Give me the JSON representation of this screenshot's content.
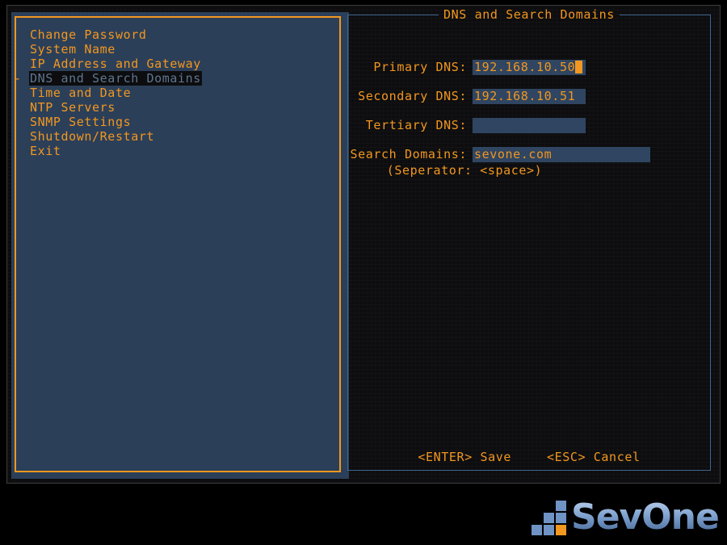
{
  "screen": {
    "background_color": "#000000",
    "terminal_background": "#0d0d0f",
    "accent_color": "#f2971f",
    "panel_fill_color": "#2b3f59",
    "panel_border_color": "#3f6591",
    "input_fill_color": "#2f4561",
    "selected_text_color": "#5f768f"
  },
  "menu": {
    "marker": "-",
    "items": [
      {
        "label": "Change Password",
        "selected": false
      },
      {
        "label": "System Name",
        "selected": false
      },
      {
        "label": "IP Address and Gateway",
        "selected": false
      },
      {
        "label": "DNS and Search Domains",
        "selected": true
      },
      {
        "label": "Time and Date",
        "selected": false
      },
      {
        "label": "NTP Servers",
        "selected": false
      },
      {
        "label": "SNMP Settings",
        "selected": false
      },
      {
        "label": "Shutdown/Restart",
        "selected": false
      },
      {
        "label": "Exit",
        "selected": false
      }
    ]
  },
  "form": {
    "title": "DNS and Search Domains",
    "fields": [
      {
        "label": "Primary DNS:",
        "value": "192.168.10.50",
        "placeholder": "",
        "focused": true,
        "width_class": "w-dns"
      },
      {
        "label": "Secondary DNS:",
        "value": "192.168.10.51",
        "placeholder": "",
        "focused": false,
        "width_class": "w-dns"
      },
      {
        "label": "Tertiary DNS:",
        "value": "",
        "placeholder": "",
        "focused": false,
        "width_class": "w-dns"
      },
      {
        "label": "Search Domains:",
        "value": "sevone.com",
        "placeholder": "",
        "focused": false,
        "width_class": "w-search"
      }
    ],
    "hint": "(Seperator: <space>)",
    "actions": [
      {
        "key": "<ENTER>",
        "label": "Save"
      },
      {
        "key": "<ESC>",
        "label": "Cancel"
      }
    ]
  },
  "logo": {
    "text": "SevOne",
    "mark_color": "#6f93c4",
    "mark_accent_color": "#f2971f",
    "text_color": "#8fb1da"
  }
}
